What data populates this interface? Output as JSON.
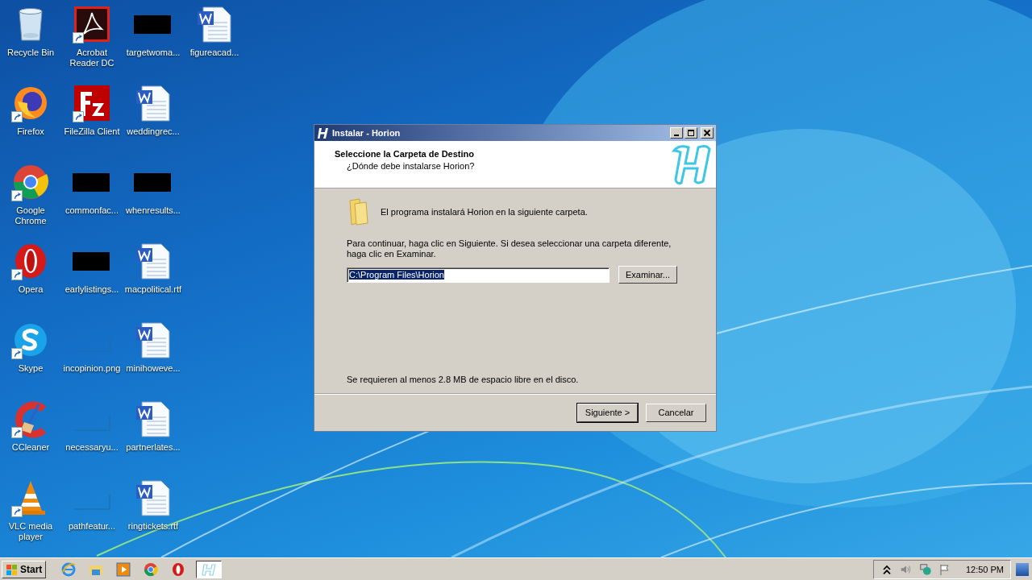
{
  "desktop_icons": [
    {
      "label": "Recycle Bin",
      "kind": "recycle",
      "shortcut": false
    },
    {
      "label": "Firefox",
      "kind": "firefox",
      "shortcut": true
    },
    {
      "label": "Google Chrome",
      "kind": "chrome",
      "shortcut": true
    },
    {
      "label": "Opera",
      "kind": "opera",
      "shortcut": true
    },
    {
      "label": "Skype",
      "kind": "skype",
      "shortcut": true
    },
    {
      "label": "CCleaner",
      "kind": "ccleaner",
      "shortcut": true
    },
    {
      "label": "VLC media player",
      "kind": "vlc",
      "shortcut": true
    },
    {
      "label": "Acrobat Reader DC",
      "kind": "acrobat",
      "shortcut": true
    },
    {
      "label": "FileZilla Client",
      "kind": "filezilla",
      "shortcut": true
    },
    {
      "label": "commonfac...",
      "kind": "redacted",
      "shortcut": false
    },
    {
      "label": "earlylistings...",
      "kind": "redacted",
      "shortcut": false
    },
    {
      "label": "incopinion.png",
      "kind": "blank",
      "shortcut": false
    },
    {
      "label": "necessaryu...",
      "kind": "blank",
      "shortcut": false
    },
    {
      "label": "pathfeatur...",
      "kind": "blank",
      "shortcut": false
    },
    {
      "label": "targetwoma...",
      "kind": "redacted",
      "shortcut": false
    },
    {
      "label": "weddingrec...",
      "kind": "word",
      "shortcut": false
    },
    {
      "label": "whenresults...",
      "kind": "redacted",
      "shortcut": false
    },
    {
      "label": "macpolitical.rtf",
      "kind": "word",
      "shortcut": false
    },
    {
      "label": "minihoweve...",
      "kind": "word",
      "shortcut": false
    },
    {
      "label": "partnerlates...",
      "kind": "word",
      "shortcut": false
    },
    {
      "label": "ringtickets.rtf",
      "kind": "word",
      "shortcut": false
    },
    {
      "label": "figureacad...",
      "kind": "word",
      "shortcut": false
    }
  ],
  "dialog": {
    "title": "Instalar - Horion",
    "heading": "Seleccione la Carpeta de Destino",
    "subheading": "¿Dónde debe instalarse Horion?",
    "intro": "El programa instalará Horion en la siguiente carpeta.",
    "instructions": "Para continuar, haga clic en Siguiente. Si desea seleccionar una carpeta diferente, haga clic en Examinar.",
    "path": {
      "value": "C:\\Program Files\\Horion",
      "selected": true
    },
    "browse_button": "Examinar...",
    "space_note": "Se requieren al menos 2.8 MB de espacio libre en el disco.",
    "buttons": [
      {
        "label": "Siguiente >",
        "default": true
      },
      {
        "label": "Cancelar",
        "default": false
      }
    ]
  },
  "taskbar": {
    "start": "Start",
    "quick_launch": [
      {
        "kind": "ie"
      },
      {
        "kind": "explorer"
      },
      {
        "kind": "media"
      },
      {
        "kind": "chrome"
      },
      {
        "kind": "opera"
      }
    ],
    "tasks": [
      {
        "kind": "installer",
        "selected": true
      }
    ],
    "clock": "12:50 PM"
  }
}
